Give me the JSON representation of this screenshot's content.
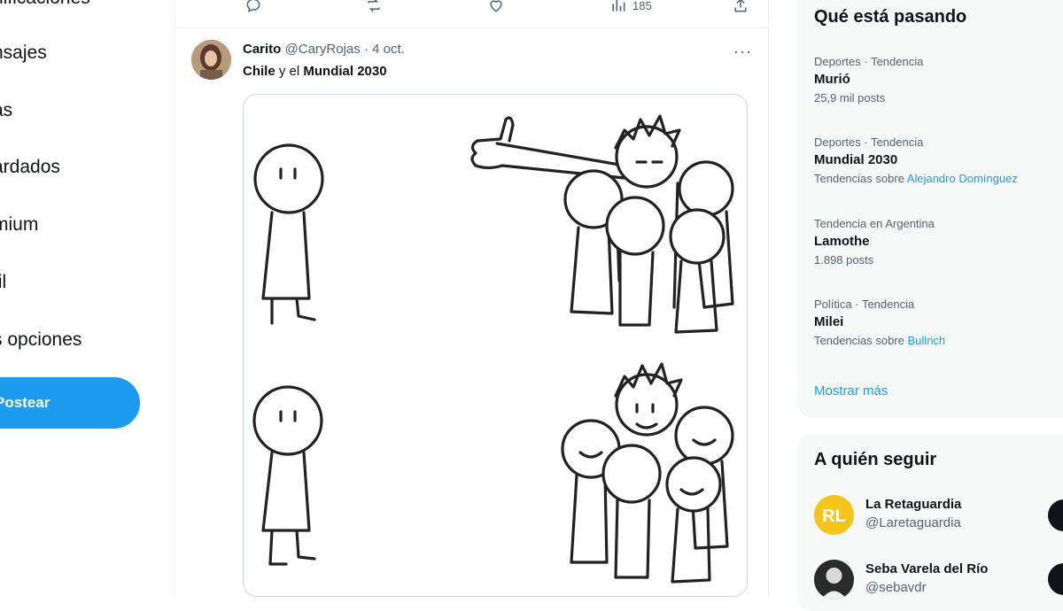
{
  "nav": {
    "items": [
      "nificaciones",
      "nsajes",
      "as",
      "ardados",
      "mium",
      "fil",
      "s opciones"
    ],
    "post_button": "Postear"
  },
  "prev_actions": {
    "views": "185"
  },
  "tweet": {
    "name": "Carito",
    "handle": "@CaryRojas",
    "date": "4 oct.",
    "more": "···",
    "text_bold_1": "Chile",
    "text_mid": " y el ",
    "text_bold_2": "Mundial 2030"
  },
  "trends": {
    "title": "Qué está pasando",
    "items": [
      {
        "context": "Deportes · Tendencia",
        "name": "Murió",
        "sub": "25,9 mil posts",
        "link": ""
      },
      {
        "context": "Deportes · Tendencia",
        "name": "Mundial 2030",
        "sub": "Tendencias sobre ",
        "link": "Alejandro Domínguez"
      },
      {
        "context": "Tendencia en Argentina",
        "name": "Lamothe",
        "sub": "1.898 posts",
        "link": ""
      },
      {
        "context": "Política · Tendencia",
        "name": "Milei",
        "sub": "Tendencias sobre ",
        "link": "Bullrich"
      }
    ],
    "show_more": "Mostrar más"
  },
  "who_to_follow": {
    "title": "A quién seguir",
    "items": [
      {
        "name": "La Retaguardia",
        "handle": "@Laretaguardia"
      },
      {
        "name": "Seba Varela del Río",
        "handle": "@sebavdr"
      }
    ]
  },
  "colors": {
    "accent": "#1d9bf0",
    "text": "#0f1419",
    "secondary": "#536471",
    "panel": "#f7f9f9"
  }
}
